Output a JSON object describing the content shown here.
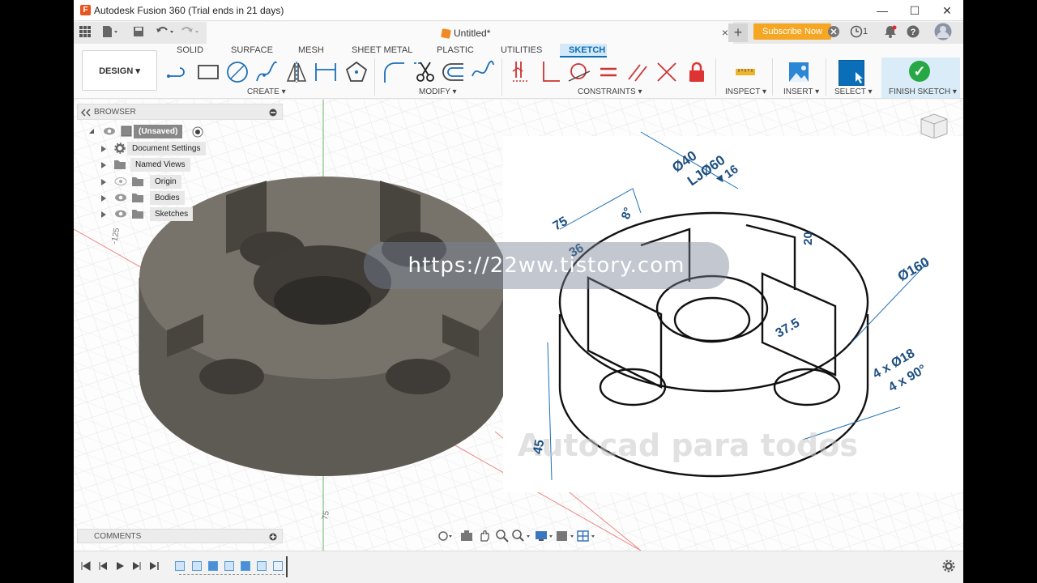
{
  "titlebar": {
    "title": "Autodesk Fusion 360 (Trial ends in 21 days)",
    "logo_letter": "F",
    "minimize": "—",
    "maximize": "☐",
    "close": "✕"
  },
  "tabbar": {
    "doc_title": "Untitled*",
    "close": "×",
    "new_tab": "+",
    "subscribe_label": "Subscribe Now",
    "job_count": "1"
  },
  "toolbar": {
    "workspace": "DESIGN ▾",
    "tabs": [
      "SOLID",
      "SURFACE",
      "MESH",
      "SHEET METAL",
      "PLASTIC",
      "UTILITIES",
      "SKETCH"
    ],
    "groups": {
      "create": "CREATE ▾",
      "modify": "MODIFY ▾",
      "constraints": "CONSTRAINTS ▾",
      "inspect": "INSPECT ▾",
      "insert": "INSERT ▾",
      "select": "SELECT ▾",
      "finish": "FINISH SKETCH ▾"
    }
  },
  "browser": {
    "title": "BROWSER",
    "items": [
      {
        "label": "(Unsaved)"
      },
      {
        "label": "Document Settings"
      },
      {
        "label": "Named Views"
      },
      {
        "label": "Origin"
      },
      {
        "label": "Bodies"
      },
      {
        "label": "Sketches"
      }
    ]
  },
  "comments": {
    "title": "COMMENTS"
  },
  "watermark": {
    "text": "https://22ww.tistory.com"
  },
  "drawing": {
    "dims": [
      "Ø40",
      "LJØ60",
      "▼16",
      "75",
      "8°",
      "36",
      "20",
      "Ø160",
      "37.5",
      "4 x Ø18",
      "4 x 90°",
      "45"
    ],
    "watermark_text": "Autocad para todos"
  },
  "axis": {
    "tick_top": "-125",
    "tick_bottom": "75"
  },
  "colors": {
    "accent": "#0a6fb8",
    "subscribe": "#f5a623",
    "finish": "#27a844",
    "body": "#6b6860"
  }
}
